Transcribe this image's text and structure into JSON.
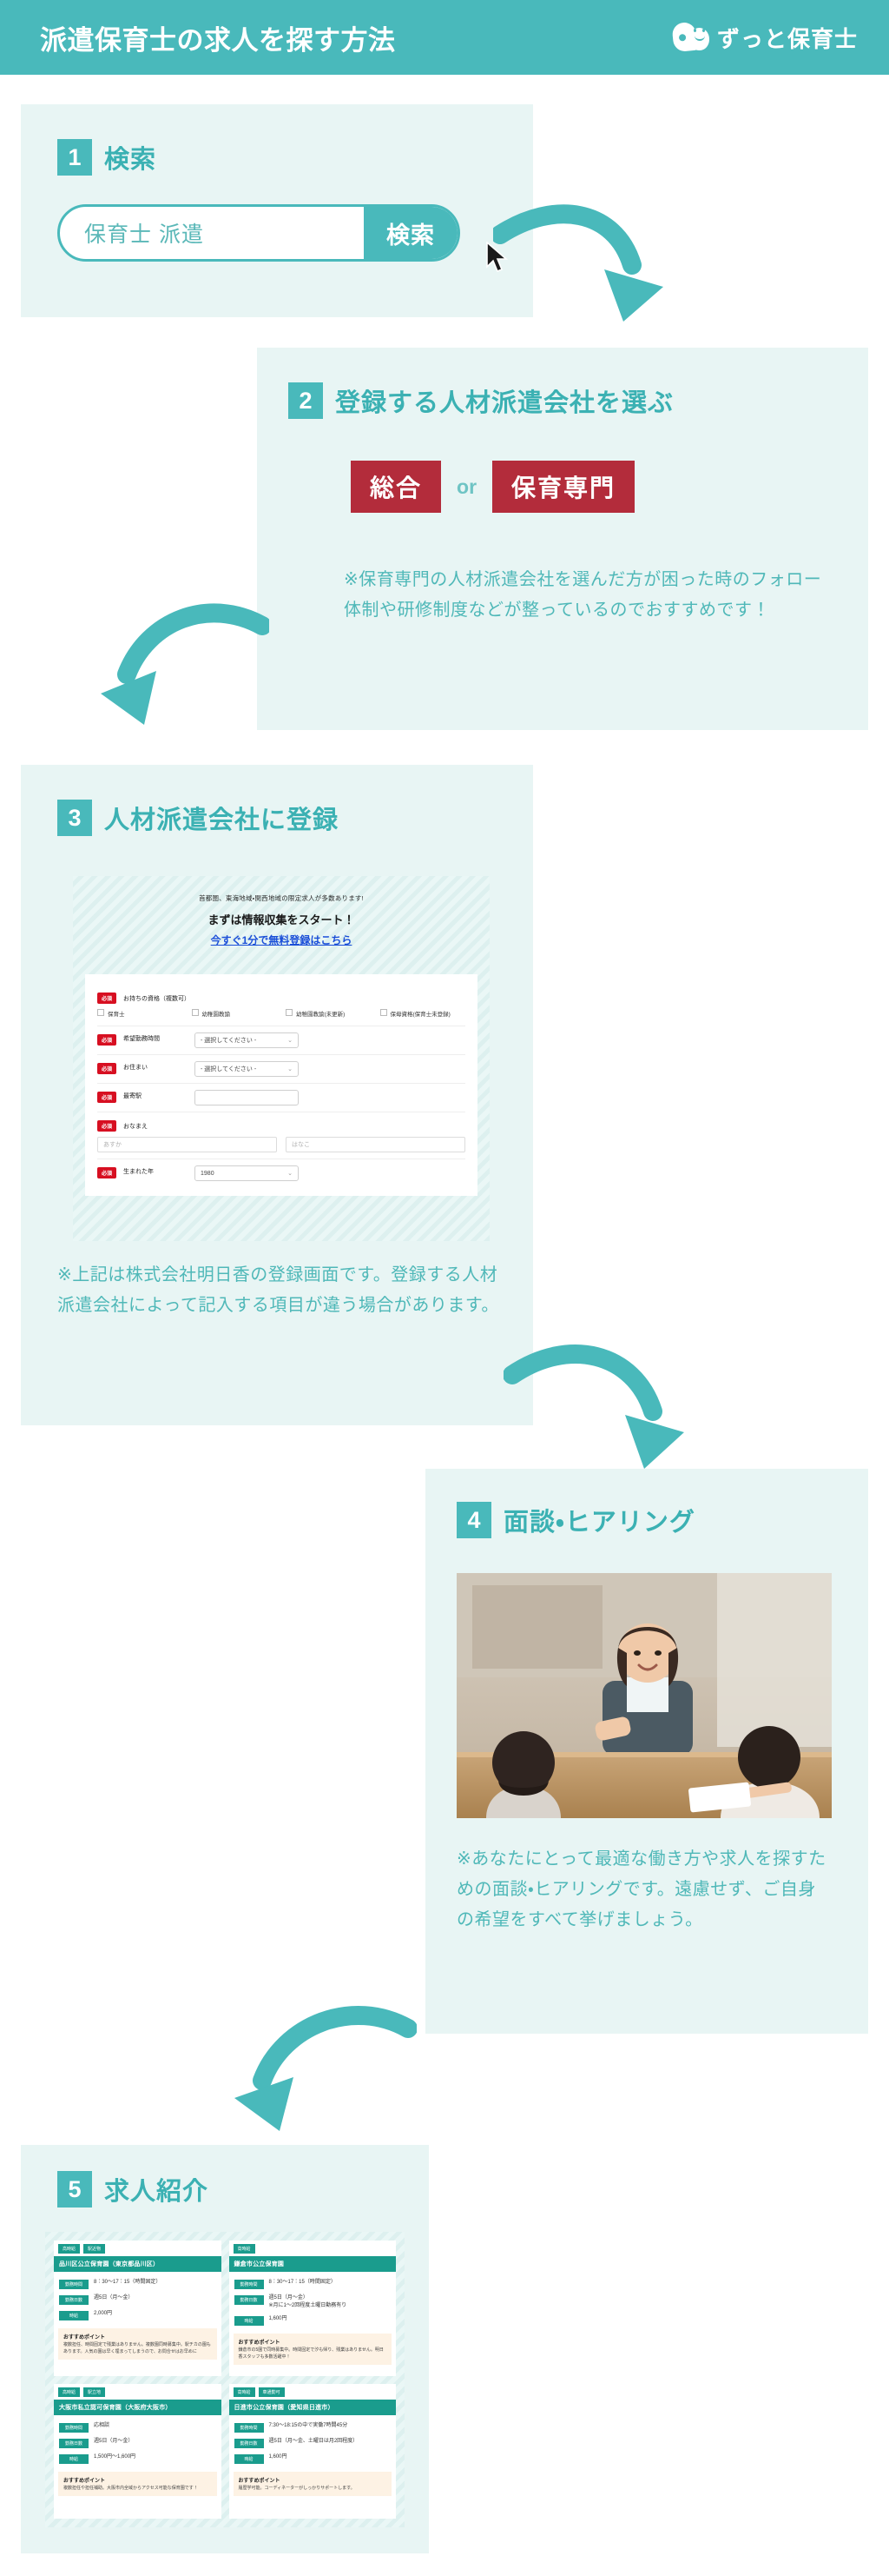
{
  "header": {
    "title": "派遣保育士の求人を探す方法",
    "logo_text": "ずっと保育士",
    "accent_color": "#49b9bb",
    "panel_color": "#e8f5f4",
    "red_color": "#b32c3b"
  },
  "step1": {
    "number": "1",
    "title": "検索",
    "search_value": "保育士 派遣",
    "search_placeholder": "保育士 派遣",
    "search_button": "検索"
  },
  "step2": {
    "number": "2",
    "title": "登録する人材派遣会社を選ぶ",
    "badge_left": "総合",
    "badge_or": "or",
    "badge_right": "保育専門",
    "note": "※保育専門の人材派遣会社を選んだ方が困った時のフォロー体制や研修制度などが整っているのでおすすめです！"
  },
  "step3": {
    "number": "3",
    "title": "人材派遣会社に登録",
    "note": "※上記は株式会社明日香の登録画面です。登録する人材派遣会社によって記入する項目が違う場合があります。",
    "form": {
      "lead": "首都圏、東海地域・関西地域の限定求人が多数あります!",
      "heading": "まずは情報収集をスタート！",
      "link": "今すぐ1分で無料登録はこちら",
      "required_badge": "必須",
      "select_placeholder": "- 選択してください -",
      "chevron": "⌄",
      "fields": [
        {
          "label": "お持ちの資格（複数可）",
          "type": "checkboxes",
          "options": [
            "保育士",
            "幼稚園教諭",
            "幼稚園教諭(未更新)",
            "保母資格(保育士未登録)"
          ]
        },
        {
          "label": "希望勤務時間",
          "type": "select",
          "value": "- 選択してください -"
        },
        {
          "label": "お住まい",
          "type": "select",
          "value": "- 選択してください -"
        },
        {
          "label": "最寄駅",
          "type": "text",
          "value": ""
        },
        {
          "label": "おなまえ",
          "type": "names",
          "placeholders": [
            "あすか",
            "はなこ"
          ]
        },
        {
          "label": "生まれた年",
          "type": "select",
          "value": "1980"
        }
      ]
    }
  },
  "step4": {
    "number": "4",
    "title": "面談・ヒアリング",
    "photo_alt": "面談の様子",
    "note": "※あなたにとって最適な働き方や求人を探すための面談・ヒアリングです。遠慮せず、ご自身の希望をすべて挙げましょう。"
  },
  "step5": {
    "number": "5",
    "title": "求人紹介",
    "point_label": "おすすめポイント",
    "keys": {
      "hours": "勤務時間",
      "days": "勤務日数",
      "wage": "時給"
    },
    "jobs": [
      {
        "tags": [
          "高時給",
          "駅近物"
        ],
        "title": "品川区公立保育園（東京都品川区）",
        "hours": "8：30～17：15（時間固定）",
        "days": "週5日（月～金）",
        "wage": "2,000円",
        "point": "複数担任、時間固定で残業はありません。複数園同時募集中。駅チカの園もあります。人気の園は早く埋まってしまうので、お問合せはお早めに"
      },
      {
        "tags": [
          "高時給"
        ],
        "title": "鎌倉市公立保育園",
        "hours": "8：30～17：15（時間固定）",
        "days": "週5日（月～金）\n※月に1～2回程度土曜日勤務有り",
        "wage": "1,600円",
        "point": "鎌倉市の5園で同時募集中。時間固定で汐も帰り、残業はありません。明日香スタッフも多数活躍中！"
      },
      {
        "tags": [
          "高時給",
          "駅立地"
        ],
        "title": "大阪市私立認可保育園（大阪府大阪市）",
        "hours": "応相談",
        "days": "週5日（月～金）",
        "wage": "1,500円～1,600円",
        "point": "複数担任や担任補助。大阪市内全域からアクセス可能な保育園です！"
      },
      {
        "tags": [
          "高時給",
          "車通勤可"
        ],
        "title": "日進市公立保育園（愛知県日進市）",
        "hours": "7:30～18:15の中で実働7時間45分",
        "days": "週5日（月～金、土曜日は月2回程度）",
        "wage": "1,600円",
        "point": "履歴学可能。コーディネーターがしっかりサポートします。"
      }
    ]
  }
}
